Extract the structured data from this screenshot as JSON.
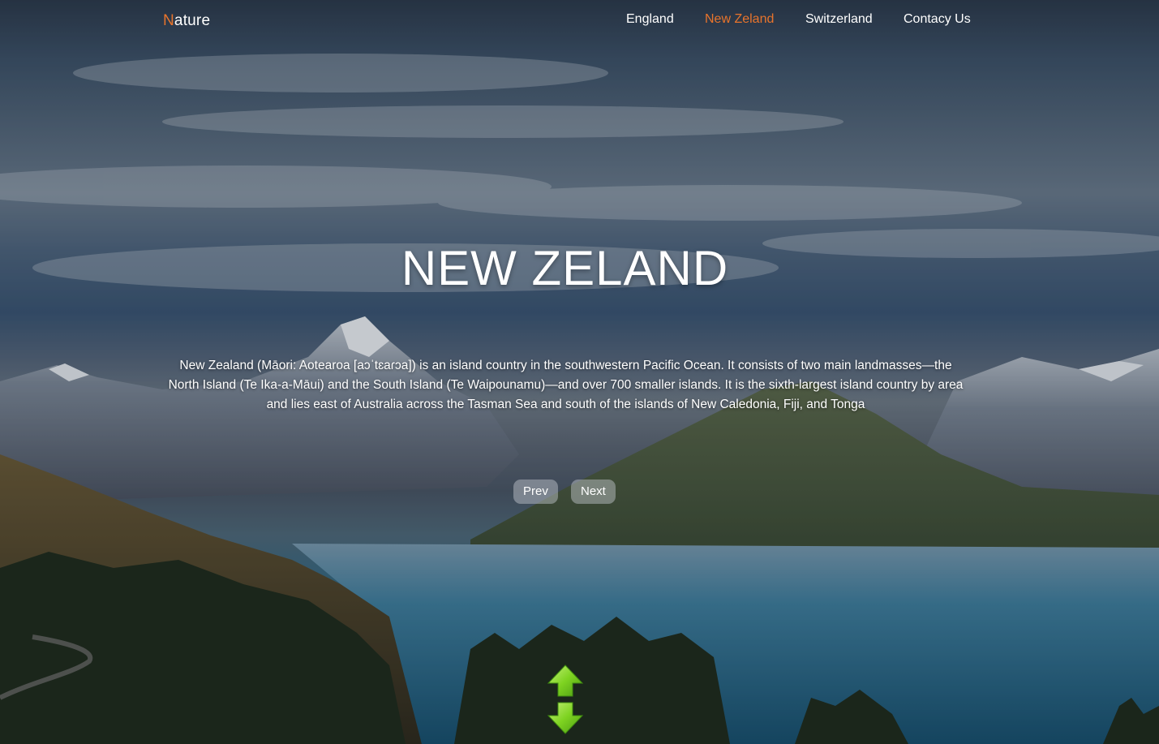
{
  "brand": {
    "first_letter": "N",
    "rest": "ature",
    "accent_color": "#e8742c"
  },
  "nav": {
    "items": [
      {
        "label": "England",
        "active": false
      },
      {
        "label": "New Zeland",
        "active": true
      },
      {
        "label": "Switzerland",
        "active": false
      },
      {
        "label": "Contacy Us",
        "active": false
      }
    ]
  },
  "hero": {
    "title": "NEW ZELAND",
    "description": "New Zealand (Māori: Aotearoa [aɔˈtɛaɾɔa]) is an island country in the southwestern Pacific Ocean. It consists of two main landmasses—the North Island (Te Ika-a-Māui) and the South Island (Te Waipounamu)—and over 700 smaller islands. It is the sixth-largest island country by area and lies east of Australia across the Tasman Sea and south of the islands of New Caledonia, Fiji, and Tonga",
    "background": "mountain-lake-landscape"
  },
  "controls": {
    "prev_label": "Prev",
    "next_label": "Next",
    "scroll_icon": "up-down-arrows-icon",
    "scroll_color": "#7ed321"
  }
}
